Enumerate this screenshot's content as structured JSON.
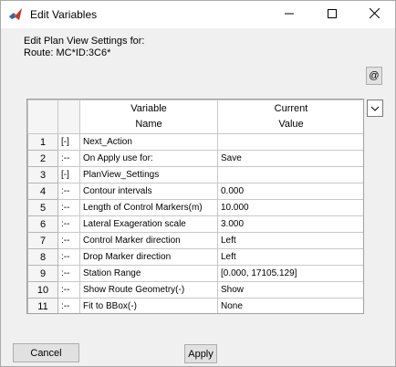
{
  "window": {
    "title": "Edit Variables"
  },
  "header": {
    "line1": "Edit Plan View Settings for:",
    "line2": "Route: MC*ID:3C6*"
  },
  "toolbar": {
    "at_label": "@"
  },
  "table": {
    "columns": [
      {
        "line1": "Variable",
        "line2": "Name"
      },
      {
        "line1": "Current",
        "line2": "Value"
      }
    ],
    "rows": [
      {
        "num": "1",
        "tree": "[-]",
        "name": "Next_Action",
        "value": ""
      },
      {
        "num": "2",
        "tree": ":--",
        "name": "On Apply use for:",
        "value": "Save"
      },
      {
        "num": "3",
        "tree": "[-]",
        "name": "PlanView_Settings",
        "value": ""
      },
      {
        "num": "4",
        "tree": ":--",
        "name": "Contour intervals",
        "value": "0.000"
      },
      {
        "num": "5",
        "tree": ":--",
        "name": "Length of  Control Markers(m)",
        "value": "10.000"
      },
      {
        "num": "6",
        "tree": ":--",
        "name": "Lateral  Exageration scale",
        "value": "3.000"
      },
      {
        "num": "7",
        "tree": ":--",
        "name": "Control  Marker direction",
        "value": "Left"
      },
      {
        "num": "8",
        "tree": ":--",
        "name": "Drop  Marker direction",
        "value": "Left"
      },
      {
        "num": "9",
        "tree": ":--",
        "name": "Station Range",
        "value": "[0.000, 17105.129]"
      },
      {
        "num": "10",
        "tree": ":--",
        "name": "Show Route Geometry(-)",
        "value": "Show"
      },
      {
        "num": "11",
        "tree": ":--",
        "name": "Fit to BBox(-)",
        "value": "None"
      }
    ]
  },
  "buttons": {
    "cancel": "Cancel",
    "apply": "Apply"
  },
  "icons": {
    "app": "matlab-icon",
    "minimize": "minimize-icon",
    "maximize": "maximize-icon",
    "close": "close-icon",
    "dropdown": "chevron-down-icon"
  }
}
